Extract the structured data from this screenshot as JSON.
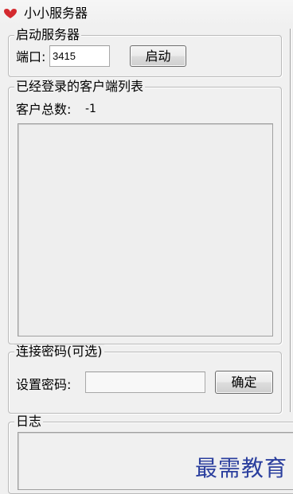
{
  "window": {
    "title": "小小服务器",
    "icon": "heart-icon"
  },
  "start_group": {
    "legend": "启动服务器",
    "port_label": "端口:",
    "port_value": "3415",
    "start_button_label": "启动"
  },
  "clients_group": {
    "legend": "已经登录的客户端列表",
    "count_label": "客户总数:",
    "count_value": "-1",
    "clients": []
  },
  "password_group": {
    "legend": "连接密码(可选)",
    "password_label": "设置密码:",
    "password_value": "",
    "confirm_button_label": "确定"
  },
  "log_group": {
    "legend": "日志",
    "log_text": ""
  },
  "watermark": "最需教育",
  "colors": {
    "icon": "#d42a2f",
    "watermark": "#2b3f9e",
    "background": "#f0f0f0"
  }
}
